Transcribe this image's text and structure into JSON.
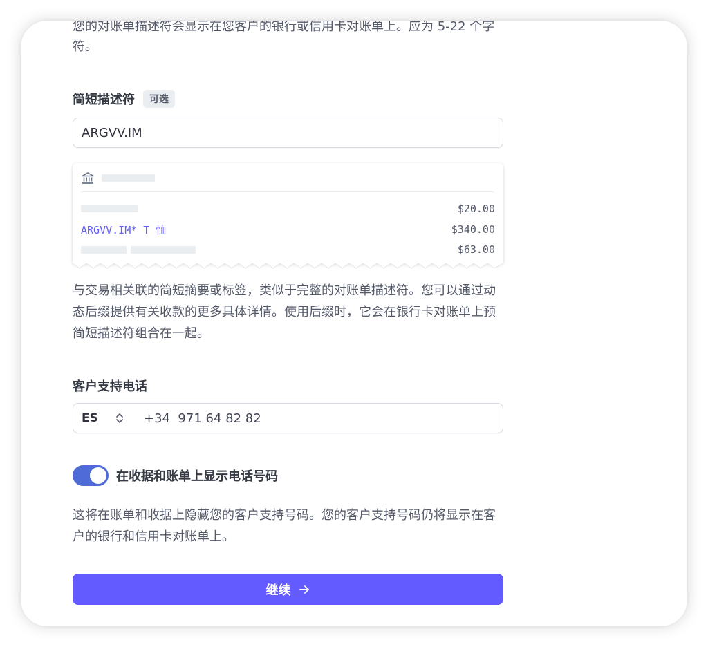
{
  "intro": {
    "text": "您的对账单描述符会显示在您客户的银行或信用卡对账单上。应为 5-22 个字符。"
  },
  "shortened_descriptor": {
    "label": "简短描述符",
    "badge": "可选",
    "value": "ARGVV.IM"
  },
  "statement_preview": {
    "bank_icon": "bank-icon",
    "rows": [
      {
        "description": "",
        "amount": "$20.00"
      },
      {
        "description": "ARGVV.IM* T 恤",
        "amount": "$340.00"
      },
      {
        "description": "",
        "amount": "$63.00"
      }
    ]
  },
  "descriptor_help": {
    "text": "与交易相关联的简短摘要或标签，类似于完整的对账单描述符。您可以通过动态后缀提供有关收款的更多具体详情。使用后缀时，它会在银行卡对账单上预简短描述符组合在一起。"
  },
  "support_phone": {
    "label": "客户支持电话",
    "country_code": "ES",
    "value": "+34  971 64 82 82"
  },
  "show_phone_toggle": {
    "label": "在收据和账单上显示电话号码",
    "on": true
  },
  "phone_help": {
    "text": "这将在账单和收据上隐藏您的客户支持号码。您的客户支持号码仍将显示在客户的银行和信用卡对账单上。"
  },
  "continue_button": {
    "label": "继续"
  },
  "colors": {
    "accent": "#635bff",
    "toggle": "#4f6bd8",
    "text": "#414552"
  }
}
